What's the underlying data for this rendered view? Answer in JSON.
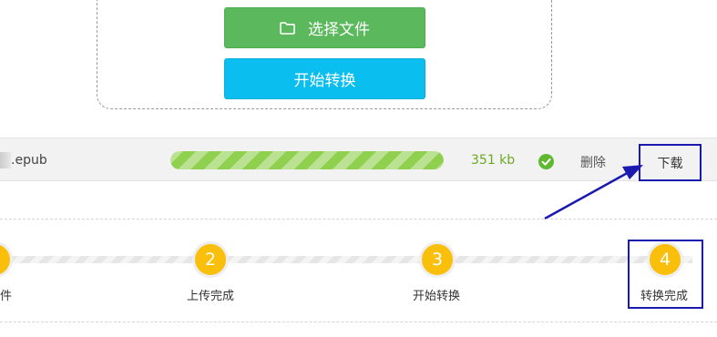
{
  "upload": {
    "select_label": "选择文件",
    "convert_label": "开始转换",
    "select_icon": "folder-icon"
  },
  "file": {
    "name": ".epub",
    "progress": 1.0,
    "size": "351 kb",
    "status_icon": "check-circle-icon",
    "delete_label": "删除",
    "download_label": "下载"
  },
  "steps": [
    {
      "number": "1",
      "label": "件"
    },
    {
      "number": "2",
      "label": "上传完成"
    },
    {
      "number": "3",
      "label": "开始转换"
    },
    {
      "number": "4",
      "label": "转换完成"
    }
  ],
  "colors": {
    "select_button": "#5cb85c",
    "convert_button": "#0abef0",
    "progress": "#8fd14f",
    "size_text": "#6aaa22",
    "step_circle": "#f9bf0a",
    "annotation": "#1a1ab0"
  }
}
